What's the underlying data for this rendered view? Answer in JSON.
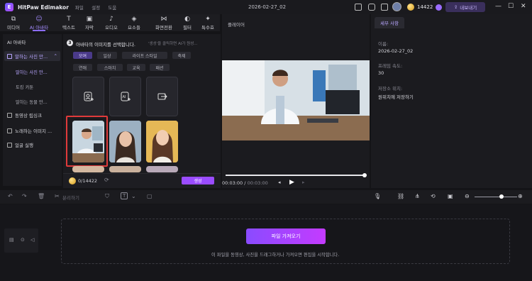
{
  "app": {
    "name": "HitPaw Edimakor",
    "menu": [
      "파일",
      "설정",
      "도움"
    ],
    "doc_title": "2026-02-27_02",
    "credits": "14422",
    "export_label": "내보내기"
  },
  "toolbar": {
    "tools": [
      {
        "label": "미디어",
        "icon": "media-icon"
      },
      {
        "label": "AI 아바타",
        "icon": "ai-avatar-icon",
        "active": true
      },
      {
        "label": "텍스트",
        "icon": "text-icon"
      },
      {
        "label": "자막",
        "icon": "subtitle-icon"
      },
      {
        "label": "오디오",
        "icon": "audio-icon"
      },
      {
        "label": "요소들",
        "icon": "elements-icon"
      },
      {
        "label": "화면전환",
        "icon": "transition-icon"
      },
      {
        "label": "필터",
        "icon": "filter-icon"
      },
      {
        "label": "특수효",
        "icon": "effects-icon"
      }
    ]
  },
  "sidebar": {
    "header": "AI 아바타",
    "group1": "말하는 사진 만...",
    "subitems": [
      "말하는 사진 만...",
      "토킹 카툰",
      "말하는 동물 만..."
    ],
    "items": [
      "동영상 립싱크",
      "노래하는 이미지 ...",
      "얼굴 실행"
    ]
  },
  "panel": {
    "step_number": "3",
    "instruction": "아바타의 이미지를 선택합니다.",
    "hint": "'생성'을 클릭하면 AI가 원성...",
    "categories_row1": [
      "모여",
      "일상",
      "라이프 스타일",
      "축제"
    ],
    "categories_row2": [
      "연애",
      "스마치",
      "교육",
      "패션"
    ],
    "credits_value": "0/14422",
    "generate_label": "생성"
  },
  "player": {
    "title": "플레이어",
    "time_current": "00:03:00",
    "time_total": "00:03:00",
    "separator": "/"
  },
  "props": {
    "tab": "세부 사항",
    "name_label": "이름:",
    "name_value": "2026-02-27_02",
    "fps_label": "프레임 속도:",
    "fps_value": "30",
    "location_label": "저장소 위치:",
    "location_value": "원위치에 저장하기"
  },
  "timeline": {
    "split_label": "분리하기",
    "import_label": "파일 가져오기",
    "hint": "이 파일을 동영상, 사진을 드래그하거나 가져오면 편집을 시작합니다."
  },
  "colors": {
    "accent": "#8b6cff",
    "import_start": "#8a4bff",
    "import_end": "#c43bff",
    "selection": "#e03a3a"
  }
}
